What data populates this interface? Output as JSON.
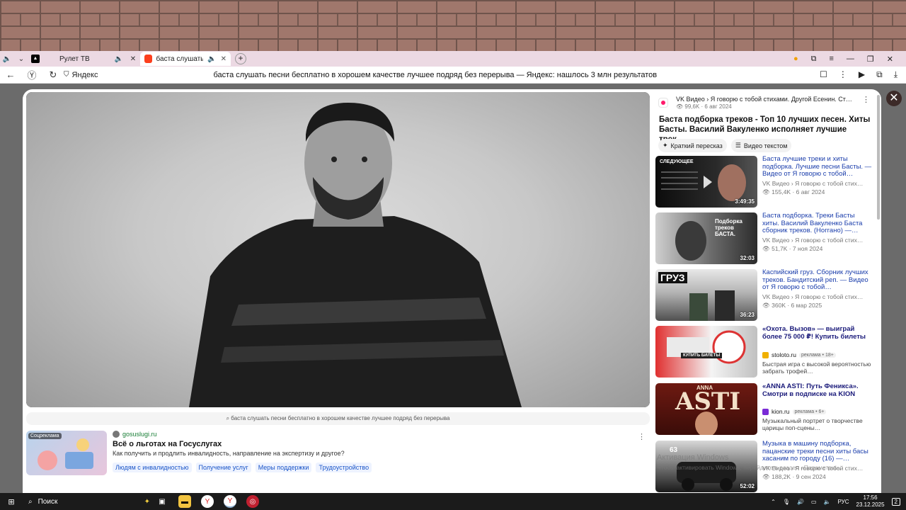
{
  "browser": {
    "tabs": [
      {
        "label": "Рулет ТВ",
        "active": false
      },
      {
        "label": "баста слушать песни",
        "active": true
      }
    ],
    "address_site": "Яндекс",
    "page_title": "баста слушать песни бесплатно в хорошем качестве лучшее подряд без перерыва — Яндекс: нашлось 3 млн результатов"
  },
  "player": {
    "query": "баста слушать песни бесплатно в хорошем качестве лучшее подряд без перерыва"
  },
  "ad": {
    "badge": "Соцреклама",
    "domain": "gosuslugi.ru",
    "title": "Всё о льготах на Госуслугах",
    "desc": "Как получить и продлить инвалидность, направление на экспертизу и другое?",
    "links": [
      "Людям с инвалидностью",
      "Получение услуг",
      "Меры поддержки",
      "Трудоустройство"
    ]
  },
  "video": {
    "source": "VK Видео › Я говорю с тобой стихами. Другой Есенин. Ст…",
    "views": "99,6K",
    "date": "6 авг 2024",
    "stats": "99,6K · 6 авг 2024",
    "title": "Баста подборка треков - Топ 10 лучших песен. Хиты Басты. Василий Вакуленко исполняет лучшие трек…",
    "buttons": {
      "summary": "Краткий пересказ",
      "text": "Видео текстом"
    }
  },
  "related": [
    {
      "title": "Баста лучшие треки и хиты подборка. Лучшие песни Басты. — Видео от Я говорю с тобой…",
      "source": "VK Видео › Я говорю с тобой стих…",
      "stats": "155,4K · 6 авг 2024",
      "duration": "3:49:35",
      "next_label": "СЛЕДУЮЩЕЕ"
    },
    {
      "title": "Баста подборка. Треки Басты хиты. Василий Вакуленко Баста сборник треков. (Ноггано) —…",
      "source": "VK Видео › Я говорю с тобой стих…",
      "stats": "51,7K · 7 ноя 2024",
      "duration": "32:03",
      "thumb_text": "Подборка треков БАСТА."
    },
    {
      "title": "Каспийский груз. Сборник лучших треков. Бандитский реп. — Видео от Я говорю с тобой…",
      "source": "VK Видео › Я говорю с тобой стих…",
      "stats": "360K · 6 мар 2025",
      "duration": "36:23",
      "thumb_text": "ГРУЗ"
    },
    {
      "title": "«Охота. Вызов» — выиграй более 75 000 ₽! Купить билеты",
      "domain": "stoloto.ru",
      "ad_label": "реклама",
      "age": "18+",
      "desc": "Быстрая игра с высокой вероятностью забрать трофей…",
      "thumb_text": "КУПИТЬ БИЛЕТЫ"
    },
    {
      "title": "«ANNA ASTI: Путь Феникса». Смотри в подписке на KION",
      "domain": "kion.ru",
      "ad_label": "реклама",
      "age": "6+",
      "desc": "Музыкальный портрет о творчестве царицы поп-сцены…",
      "thumb_text": "ASTI",
      "thumb_text_small": "ANNA"
    },
    {
      "title": "Музыка в машину подборка, пацанские треки песни хиты басы хасаним по городу (16) —…",
      "source": "VK Видео › Я говорю с тобой стих…",
      "stats": "188,2K · 9 сен 2024",
      "duration": "52:02",
      "thumb_text": "63"
    }
  ],
  "watermark": {
    "line1": "Активация Windows",
    "line2": "Чтобы активировать Windows, перейдите в раздел «Параметры»."
  },
  "taskbar": {
    "search": "Поиск",
    "lang": "РУС",
    "time": "17:56",
    "date": "23.12.2025",
    "notifications": "2"
  },
  "colors": {
    "link": "#1a3dab",
    "ad_link_bg": "#eef3ff",
    "taskbar": "#1b1b1b",
    "tabbar": "#ecd9e3"
  }
}
